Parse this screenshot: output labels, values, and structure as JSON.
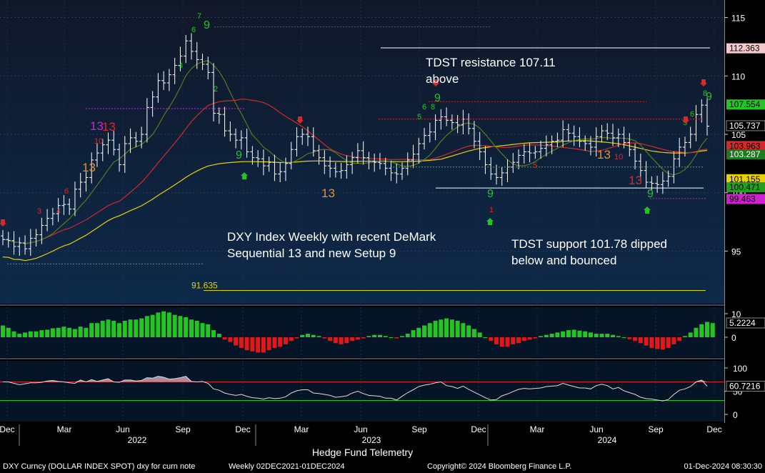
{
  "chart_data": {
    "type": "candlestick",
    "title": "DXY Index Weekly with recent DeMark Sequential 13 and new Setup 9",
    "instrument": "DXY Curncy (DOLLAR INDEX SPOT) dxy for curn note",
    "period": "Weekly 02DEC2021-01DEC2024",
    "footer_center": "Hedge Fund Telemetry",
    "copyright": "Copyright© 2024 Bloomberg Finance L.P.",
    "timestamp": "01-Dec-2024 08:30:30",
    "x_ticks": [
      "Dec",
      "Mar",
      "Jun",
      "Sep",
      "Dec",
      "Mar",
      "Jun",
      "Sep",
      "Dec",
      "Mar",
      "Jun",
      "Sep",
      "Dec"
    ],
    "x_years": [
      "2022",
      "2023",
      "2024"
    ],
    "price_axis": {
      "ticks": [
        95,
        100,
        105,
        110,
        115
      ],
      "ylim": [
        90.5,
        116.5
      ]
    },
    "price_labels": [
      {
        "value": 112.363,
        "text": "112.363",
        "bg": "#f7c9cf",
        "fg": "#000000"
      },
      {
        "value": 107.554,
        "text": "107.554",
        "bg": "#22c522",
        "fg": "#000000"
      },
      {
        "value": 105.737,
        "text": "105.737",
        "bg": "#000000",
        "fg": "#ffffff"
      },
      {
        "value": 104.0,
        "text": "103.963",
        "bg": "#d42a2a",
        "fg": "#000000"
      },
      {
        "value": 103.287,
        "text": "103.287",
        "bg": "#1e7a1e",
        "fg": "#ffffff"
      },
      {
        "value": 101.155,
        "text": "101.155",
        "bg": "#e8d200",
        "fg": "#000000"
      },
      {
        "value": 100.471,
        "text": "100.471",
        "bg": "#22a022",
        "fg": "#000000"
      },
      {
        "value": 99.463,
        "text": "99.463",
        "bg": "#d020d0",
        "fg": "#000000"
      }
    ],
    "annotations": {
      "tdst_resistance": "TDST resistance 107.11 above",
      "tdst_support": "TDST support 101.78 dipped below and bounced",
      "level_label": "91.635"
    },
    "series": [
      {
        "name": "DXY weekly",
        "close": [
          96.0,
          95.9,
          95.4,
          95.7,
          95.2,
          96.1,
          96.4,
          97.2,
          97.8,
          98.2,
          98.9,
          99.0,
          98.6,
          100.3,
          100.9,
          101.3,
          102.8,
          103.4,
          104.1,
          104.5,
          103.7,
          102.4,
          104.2,
          104.7,
          104.4,
          105.0,
          107.3,
          108.2,
          109.6,
          109.4,
          110.1,
          110.9,
          111.7,
          113.0,
          112.1,
          111.4,
          111.0,
          110.3,
          106.8,
          106.7,
          105.3,
          105.0,
          104.5,
          104.7,
          103.5,
          103.0,
          102.9,
          102.3,
          102.6,
          101.6,
          101.8,
          102.5,
          103.7,
          104.8,
          105.0,
          104.8,
          103.6,
          103.0,
          102.3,
          102.1,
          101.8,
          101.9,
          102.4,
          103.0,
          103.6,
          103.0,
          102.7,
          102.6,
          102.5,
          102.1,
          101.7,
          101.6,
          102.1,
          102.8,
          103.3,
          104.2,
          104.9,
          105.2,
          106.2,
          106.5,
          106.2,
          106.0,
          105.8,
          106.3,
          105.5,
          104.4,
          103.5,
          102.4,
          101.6,
          101.3,
          101.7,
          102.2,
          102.6,
          103.2,
          103.5,
          103.4,
          103.5,
          103.8,
          104.1,
          104.4,
          104.5,
          105.4,
          105.1,
          104.8,
          104.4,
          104.2,
          103.9,
          104.8,
          105.3,
          105.1,
          104.7,
          105.0,
          104.3,
          103.7,
          102.7,
          101.9,
          100.9,
          100.8,
          100.7,
          101.0,
          101.4,
          102.9,
          103.9,
          104.3,
          105.0,
          106.7,
          107.5,
          105.7
        ]
      },
      {
        "name": "MA short",
        "values": "computed"
      },
      {
        "name": "MA mid",
        "values": "computed"
      },
      {
        "name": "MA long",
        "values": "computed"
      }
    ],
    "momentum_panel": {
      "ticks": [
        10,
        0
      ],
      "label": "5.2224",
      "values": [
        5,
        4,
        2.5,
        1.5,
        2,
        2.5,
        2.5,
        3,
        3.2,
        3.8,
        4,
        4.5,
        4,
        3.5,
        4.5,
        4,
        6,
        6,
        7,
        7.5,
        7,
        6,
        7,
        7.5,
        7.5,
        8,
        9,
        9.5,
        10.5,
        11,
        10.5,
        9.5,
        9,
        8.5,
        7.5,
        7,
        6,
        5.5,
        3,
        1.5,
        -1,
        -2,
        -3.5,
        -4.5,
        -5.5,
        -6,
        -6.5,
        -6.5,
        -5.5,
        -4.5,
        -4,
        -3,
        -1.5,
        -0.5,
        1,
        1.5,
        1,
        0.5,
        -0.5,
        -1.5,
        -2.5,
        -3,
        -2.5,
        -1.5,
        -1,
        -0.5,
        0.5,
        1,
        1,
        0.5,
        0,
        -0.5,
        0.5,
        1.5,
        3,
        4,
        5,
        6,
        7,
        7.5,
        8,
        7.5,
        7,
        6,
        5,
        3.5,
        2,
        0,
        -1.5,
        -3,
        -4,
        -4,
        -3,
        -2.5,
        -1.5,
        -1,
        -0.5,
        0.5,
        1,
        1.5,
        2,
        2.5,
        3,
        3.2,
        2.8,
        2.5,
        2,
        1.5,
        1.5,
        1.5,
        1,
        0.5,
        0,
        -0.8,
        -1.5,
        -2.5,
        -3.5,
        -4.5,
        -5,
        -5.2,
        -4.5,
        -3,
        -1.5,
        0.5,
        2,
        4,
        5.5,
        6.5,
        6
      ]
    },
    "oscillator_panel": {
      "ticks": [
        100,
        50,
        0
      ],
      "label": "60.7216",
      "upper": 70,
      "lower": 30,
      "values": [
        70,
        70,
        67,
        64,
        66,
        68,
        68,
        69,
        72,
        73,
        71,
        70,
        68,
        67,
        74,
        70,
        75,
        71,
        74,
        77,
        70,
        69,
        74,
        74,
        72,
        73,
        79,
        78,
        82,
        80,
        76,
        77,
        79,
        82,
        71,
        70,
        71,
        67,
        55,
        52,
        46,
        43,
        41,
        43,
        39,
        36,
        35,
        33,
        36,
        34,
        35,
        38,
        46,
        51,
        53,
        53,
        46,
        45,
        43,
        41,
        37,
        38,
        40,
        46,
        50,
        45,
        41,
        40,
        39,
        35,
        35,
        31,
        39,
        47,
        53,
        60,
        63,
        65,
        68,
        70,
        62,
        60,
        56,
        61,
        54,
        48,
        42,
        36,
        31,
        32,
        40,
        44,
        49,
        54,
        56,
        55,
        56,
        57,
        60,
        61,
        62,
        67,
        63,
        60,
        57,
        57,
        55,
        62,
        65,
        62,
        55,
        58,
        51,
        47,
        43,
        37,
        34,
        33,
        31,
        29,
        32,
        43,
        52,
        55,
        60,
        70,
        74,
        61
      ]
    }
  },
  "demark": {
    "sequential13": "13",
    "setup9": "9"
  }
}
